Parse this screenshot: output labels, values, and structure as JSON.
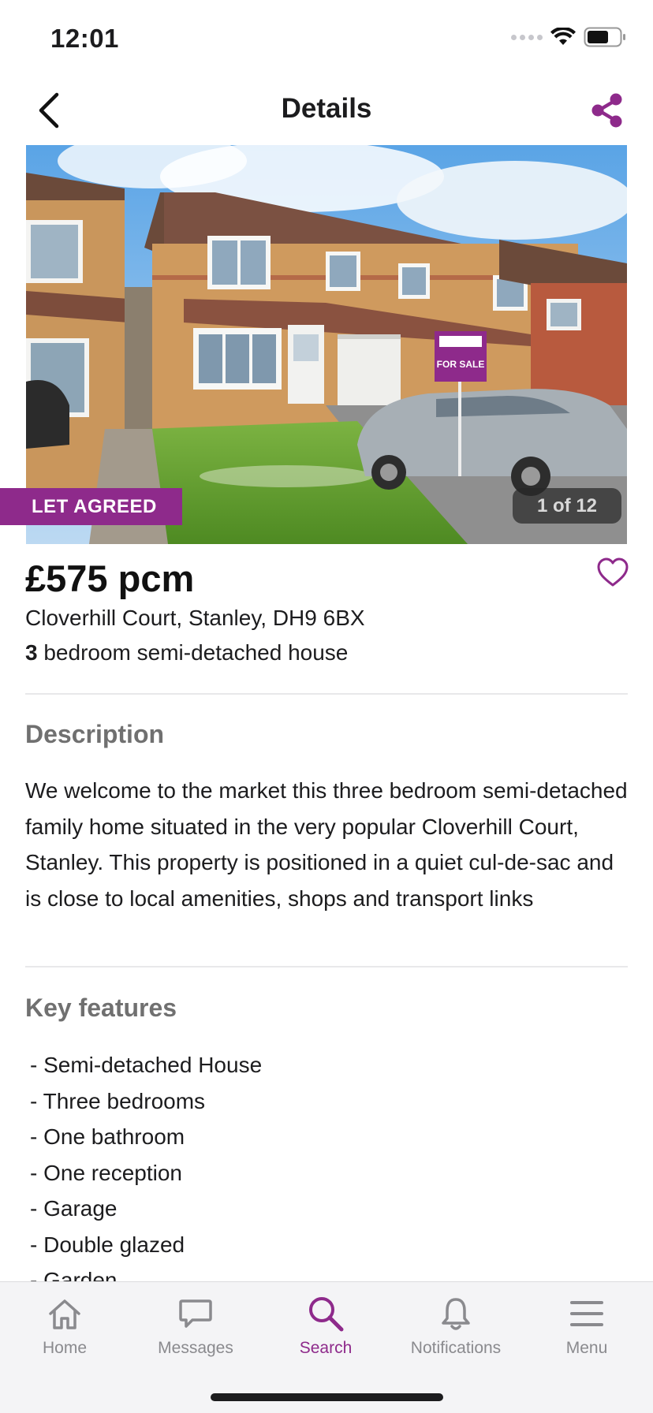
{
  "status_bar": {
    "time": "12:01"
  },
  "nav": {
    "title": "Details"
  },
  "listing": {
    "status_tag": "LET AGREED",
    "image_counter": "1 of 12",
    "sign_text": "FOR SALE",
    "price": "£575 pcm",
    "address": "Cloverhill Court, Stanley, DH9 6BX",
    "bedrooms": "3",
    "property_type": "bedroom semi-detached house"
  },
  "description": {
    "title": "Description",
    "text": "We welcome to the market this three bedroom semi-detached family home situated in the very popular Cloverhill Court, Stanley. This property is positioned in a quiet cul-de-sac and is close to local amenities, shops and transport links"
  },
  "key_features": {
    "title": "Key features",
    "items": [
      "- Semi-detached House",
      "- Three bedrooms",
      "- One bathroom",
      "- One reception",
      "- Garage",
      "- Double glazed",
      "- Garden"
    ]
  },
  "tab_bar": {
    "tabs": [
      {
        "label": "Home",
        "icon": "home-icon"
      },
      {
        "label": "Messages",
        "icon": "chat-bubble-icon"
      },
      {
        "label": "Search",
        "icon": "search-icon"
      },
      {
        "label": "Notifications",
        "icon": "bell-icon"
      },
      {
        "label": "Menu",
        "icon": "hamburger-icon"
      }
    ],
    "active_tab": "Search"
  },
  "colors": {
    "accent": "#8e2a8b",
    "text": "#1c1c1e",
    "muted": "#707070",
    "tab_inactive": "#8a8a8e"
  }
}
